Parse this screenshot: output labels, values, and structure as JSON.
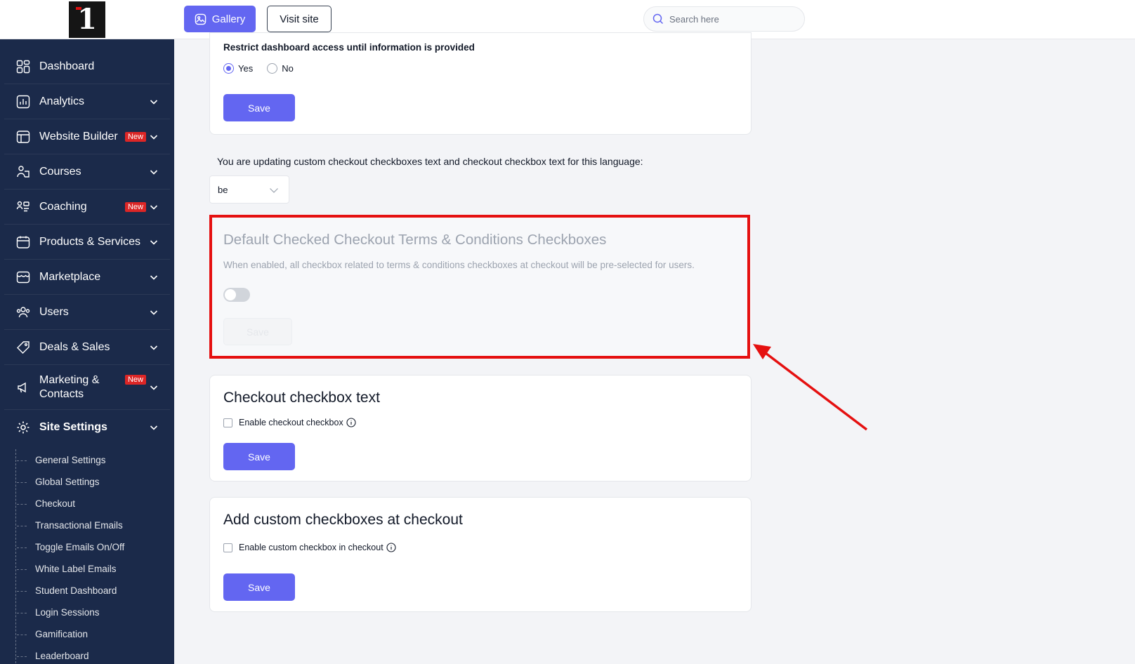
{
  "sidebar": {
    "logo_text": "1",
    "items": [
      {
        "label": "Dashboard",
        "icon": "dashboard-grid-icon",
        "badge": "",
        "chevron": false
      },
      {
        "label": "Analytics",
        "icon": "analytics-chart-icon",
        "badge": "",
        "chevron": true
      },
      {
        "label": "Website Builder",
        "icon": "website-builder-icon",
        "badge": "New",
        "chevron": true
      },
      {
        "label": "Courses",
        "icon": "courses-icon",
        "badge": "",
        "chevron": true
      },
      {
        "label": "Coaching",
        "icon": "coaching-icon",
        "badge": "New",
        "chevron": true
      },
      {
        "label": "Products & Services",
        "icon": "products-calendar-icon",
        "badge": "",
        "chevron": true
      },
      {
        "label": "Marketplace",
        "icon": "marketplace-store-icon",
        "badge": "",
        "chevron": true
      },
      {
        "label": "Users",
        "icon": "users-icon",
        "badge": "",
        "chevron": true
      },
      {
        "label": "Deals & Sales",
        "icon": "deals-tag-icon",
        "badge": "",
        "chevron": true
      },
      {
        "label_line1": "Marketing &",
        "label_line2": "Contacts",
        "icon": "marketing-megaphone-icon",
        "badge": "New",
        "chevron": true
      },
      {
        "label": "Site Settings",
        "icon": "site-settings-gear-icon",
        "badge": "",
        "chevron": true
      }
    ],
    "sub_items": [
      "General Settings",
      "Global Settings",
      "Checkout",
      "Transactional Emails",
      "Toggle Emails On/Off",
      "White Label Emails",
      "Student Dashboard",
      "Login Sessions",
      "Gamification",
      "Leaderboard"
    ]
  },
  "topbar": {
    "gallery_label": "Gallery",
    "visit_site_label": "Visit site",
    "search_placeholder": "Search here"
  },
  "restrict_card": {
    "question": "Restrict dashboard access until information is provided",
    "options": [
      "Yes",
      "No"
    ],
    "selected": "Yes",
    "save_label": "Save"
  },
  "language": {
    "text": "You are updating custom checkout checkboxes text and checkout checkbox text for this language:",
    "selected": "be"
  },
  "default_checked_card": {
    "title": "Default Checked Checkout Terms & Conditions Checkboxes",
    "description": "When enabled, all checkbox related to terms & conditions checkboxes at checkout will be pre-selected for users.",
    "toggle_on": false,
    "save_label": "Save"
  },
  "checkout_checkbox_card": {
    "title": "Checkout checkbox text",
    "checkbox_label": "Enable checkout checkbox",
    "checked": false,
    "save_label": "Save"
  },
  "custom_checkboxes_card": {
    "title": "Add custom checkboxes at checkout",
    "checkbox_label": "Enable custom checkbox in checkout",
    "checked": false,
    "save_label": "Save"
  },
  "colors": {
    "sidebar_bg": "#1b2a4a",
    "accent": "#6366f1",
    "badge": "#dc2626",
    "highlight": "#e51010"
  }
}
